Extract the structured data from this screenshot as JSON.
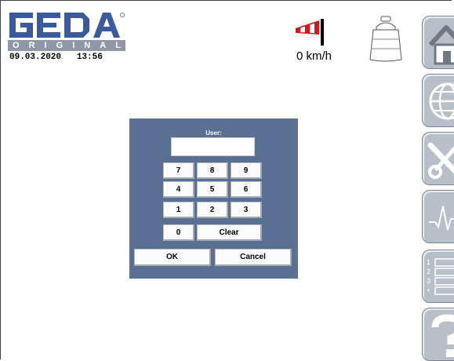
{
  "header": {
    "logo": {
      "brand": "GEDA",
      "subline_letters": [
        "O",
        "R",
        "I",
        "G",
        "I",
        "N",
        "A",
        "L"
      ]
    },
    "date": "09.03.2020",
    "time": "13:56",
    "wind_speed_value": "0",
    "wind_speed_unit": "km/h",
    "wind_icon": "wind-sock-icon",
    "load_icon": "weight-icon"
  },
  "sidebar": {
    "items": [
      {
        "icon": "home-icon"
      },
      {
        "icon": "globe-icon"
      },
      {
        "icon": "tools-icon"
      },
      {
        "icon": "chart-icon"
      },
      {
        "icon": "numbered-list-icon",
        "labels": [
          "1",
          "2",
          "3",
          "+"
        ]
      },
      {
        "icon": "help-icon"
      }
    ]
  },
  "login_dialog": {
    "title": "User:",
    "input_value": "",
    "keys": {
      "row1": [
        "7",
        "8",
        "9"
      ],
      "row2": [
        "4",
        "5",
        "6"
      ],
      "row3": [
        "1",
        "2",
        "3"
      ],
      "zero": "0",
      "clear": "Clear"
    },
    "ok_label": "OK",
    "cancel_label": "Cancel"
  },
  "colors": {
    "dialog_bg": "#5a7092",
    "logo_blue": "#3a5a9c",
    "sidebar_button": "#b8bfc8"
  }
}
